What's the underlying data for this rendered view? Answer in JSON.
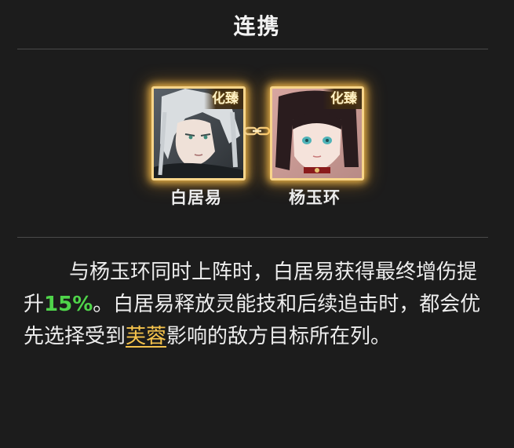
{
  "title": "连携",
  "partners": [
    {
      "name": "白居易",
      "badge": "化臻"
    },
    {
      "name": "杨玉环",
      "badge": "化臻"
    }
  ],
  "description": {
    "part1": "与杨玉环同时上阵时，白居易获得最终增伤提升",
    "bonus": "15%",
    "part2": "。白居易释放灵能技和后续追击时，都会优先选择受到",
    "keyword": "芙蓉",
    "part3": "影响的敌方目标所在列。"
  },
  "colors": {
    "background": "#1c1c1c",
    "frame_glow": "#f7d58a",
    "bonus_text": "#4fd44a",
    "keyword_text": "#f4c24c"
  },
  "icons": {
    "link": "chain-link-icon"
  }
}
